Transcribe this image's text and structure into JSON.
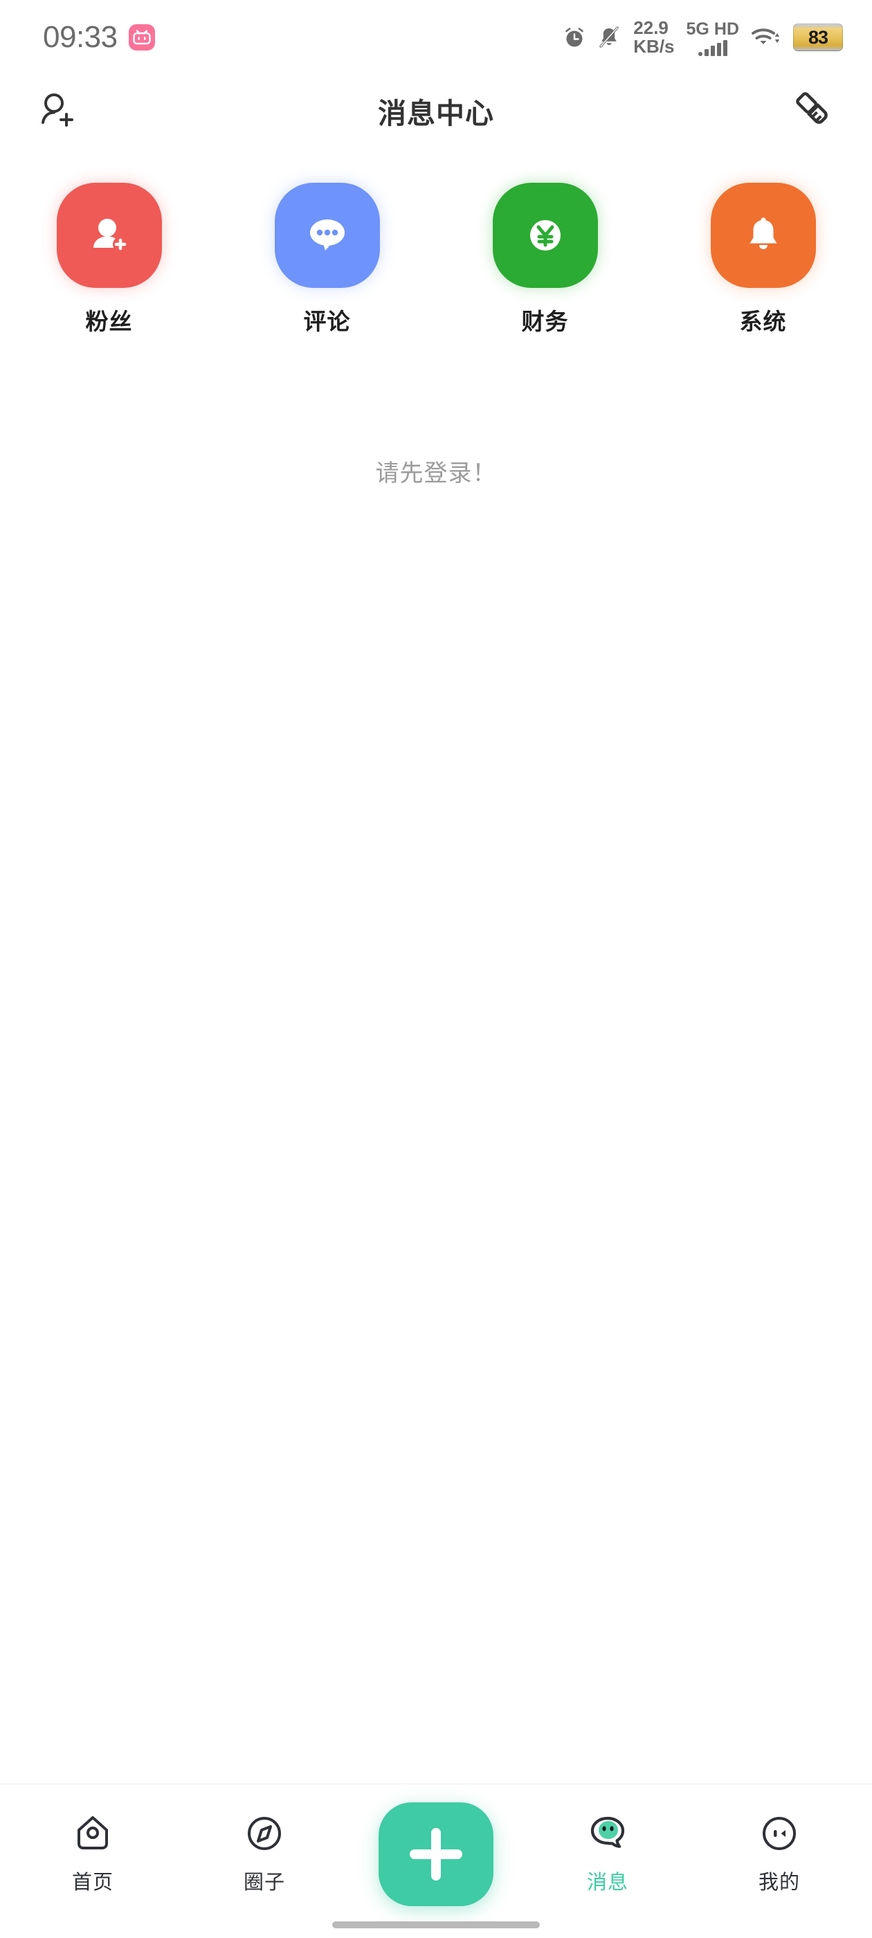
{
  "status_bar": {
    "time": "09:33",
    "app_badge": "bilibili-icon",
    "alarm_icon": "alarm-clock-icon",
    "mute_icon": "bell-muted-icon",
    "network_speed_value": "22.9",
    "network_speed_unit": "KB/s",
    "network_type": "5G",
    "hd_label": "HD",
    "signal_icon": "signal-bars-icon",
    "wifi_icon": "wifi-icon",
    "battery_level": "83"
  },
  "header": {
    "title": "消息中心",
    "left_action": "add-friend-icon",
    "right_action": "clear-all-icon"
  },
  "categories": [
    {
      "label": "粉丝",
      "icon": "person-add-icon",
      "color": "#ef5a56"
    },
    {
      "label": "评论",
      "icon": "comment-bubble-icon",
      "color": "#6e93fa"
    },
    {
      "label": "财务",
      "icon": "yuan-coin-icon",
      "color": "#2bab33"
    },
    {
      "label": "系统",
      "icon": "bell-icon",
      "color": "#f0702f"
    }
  ],
  "content": {
    "empty_message": "请先登录！"
  },
  "tabbar": {
    "active_color": "#3ccca0",
    "items": [
      {
        "label": "首页",
        "icon": "home-icon",
        "active": false
      },
      {
        "label": "圈子",
        "icon": "compass-icon",
        "active": false
      },
      {
        "label": "消息",
        "icon": "chat-face-icon",
        "active": true
      },
      {
        "label": "我的",
        "icon": "profile-face-icon",
        "active": false
      }
    ],
    "fab": {
      "icon": "plus-icon",
      "color": "#3fcba4"
    }
  }
}
